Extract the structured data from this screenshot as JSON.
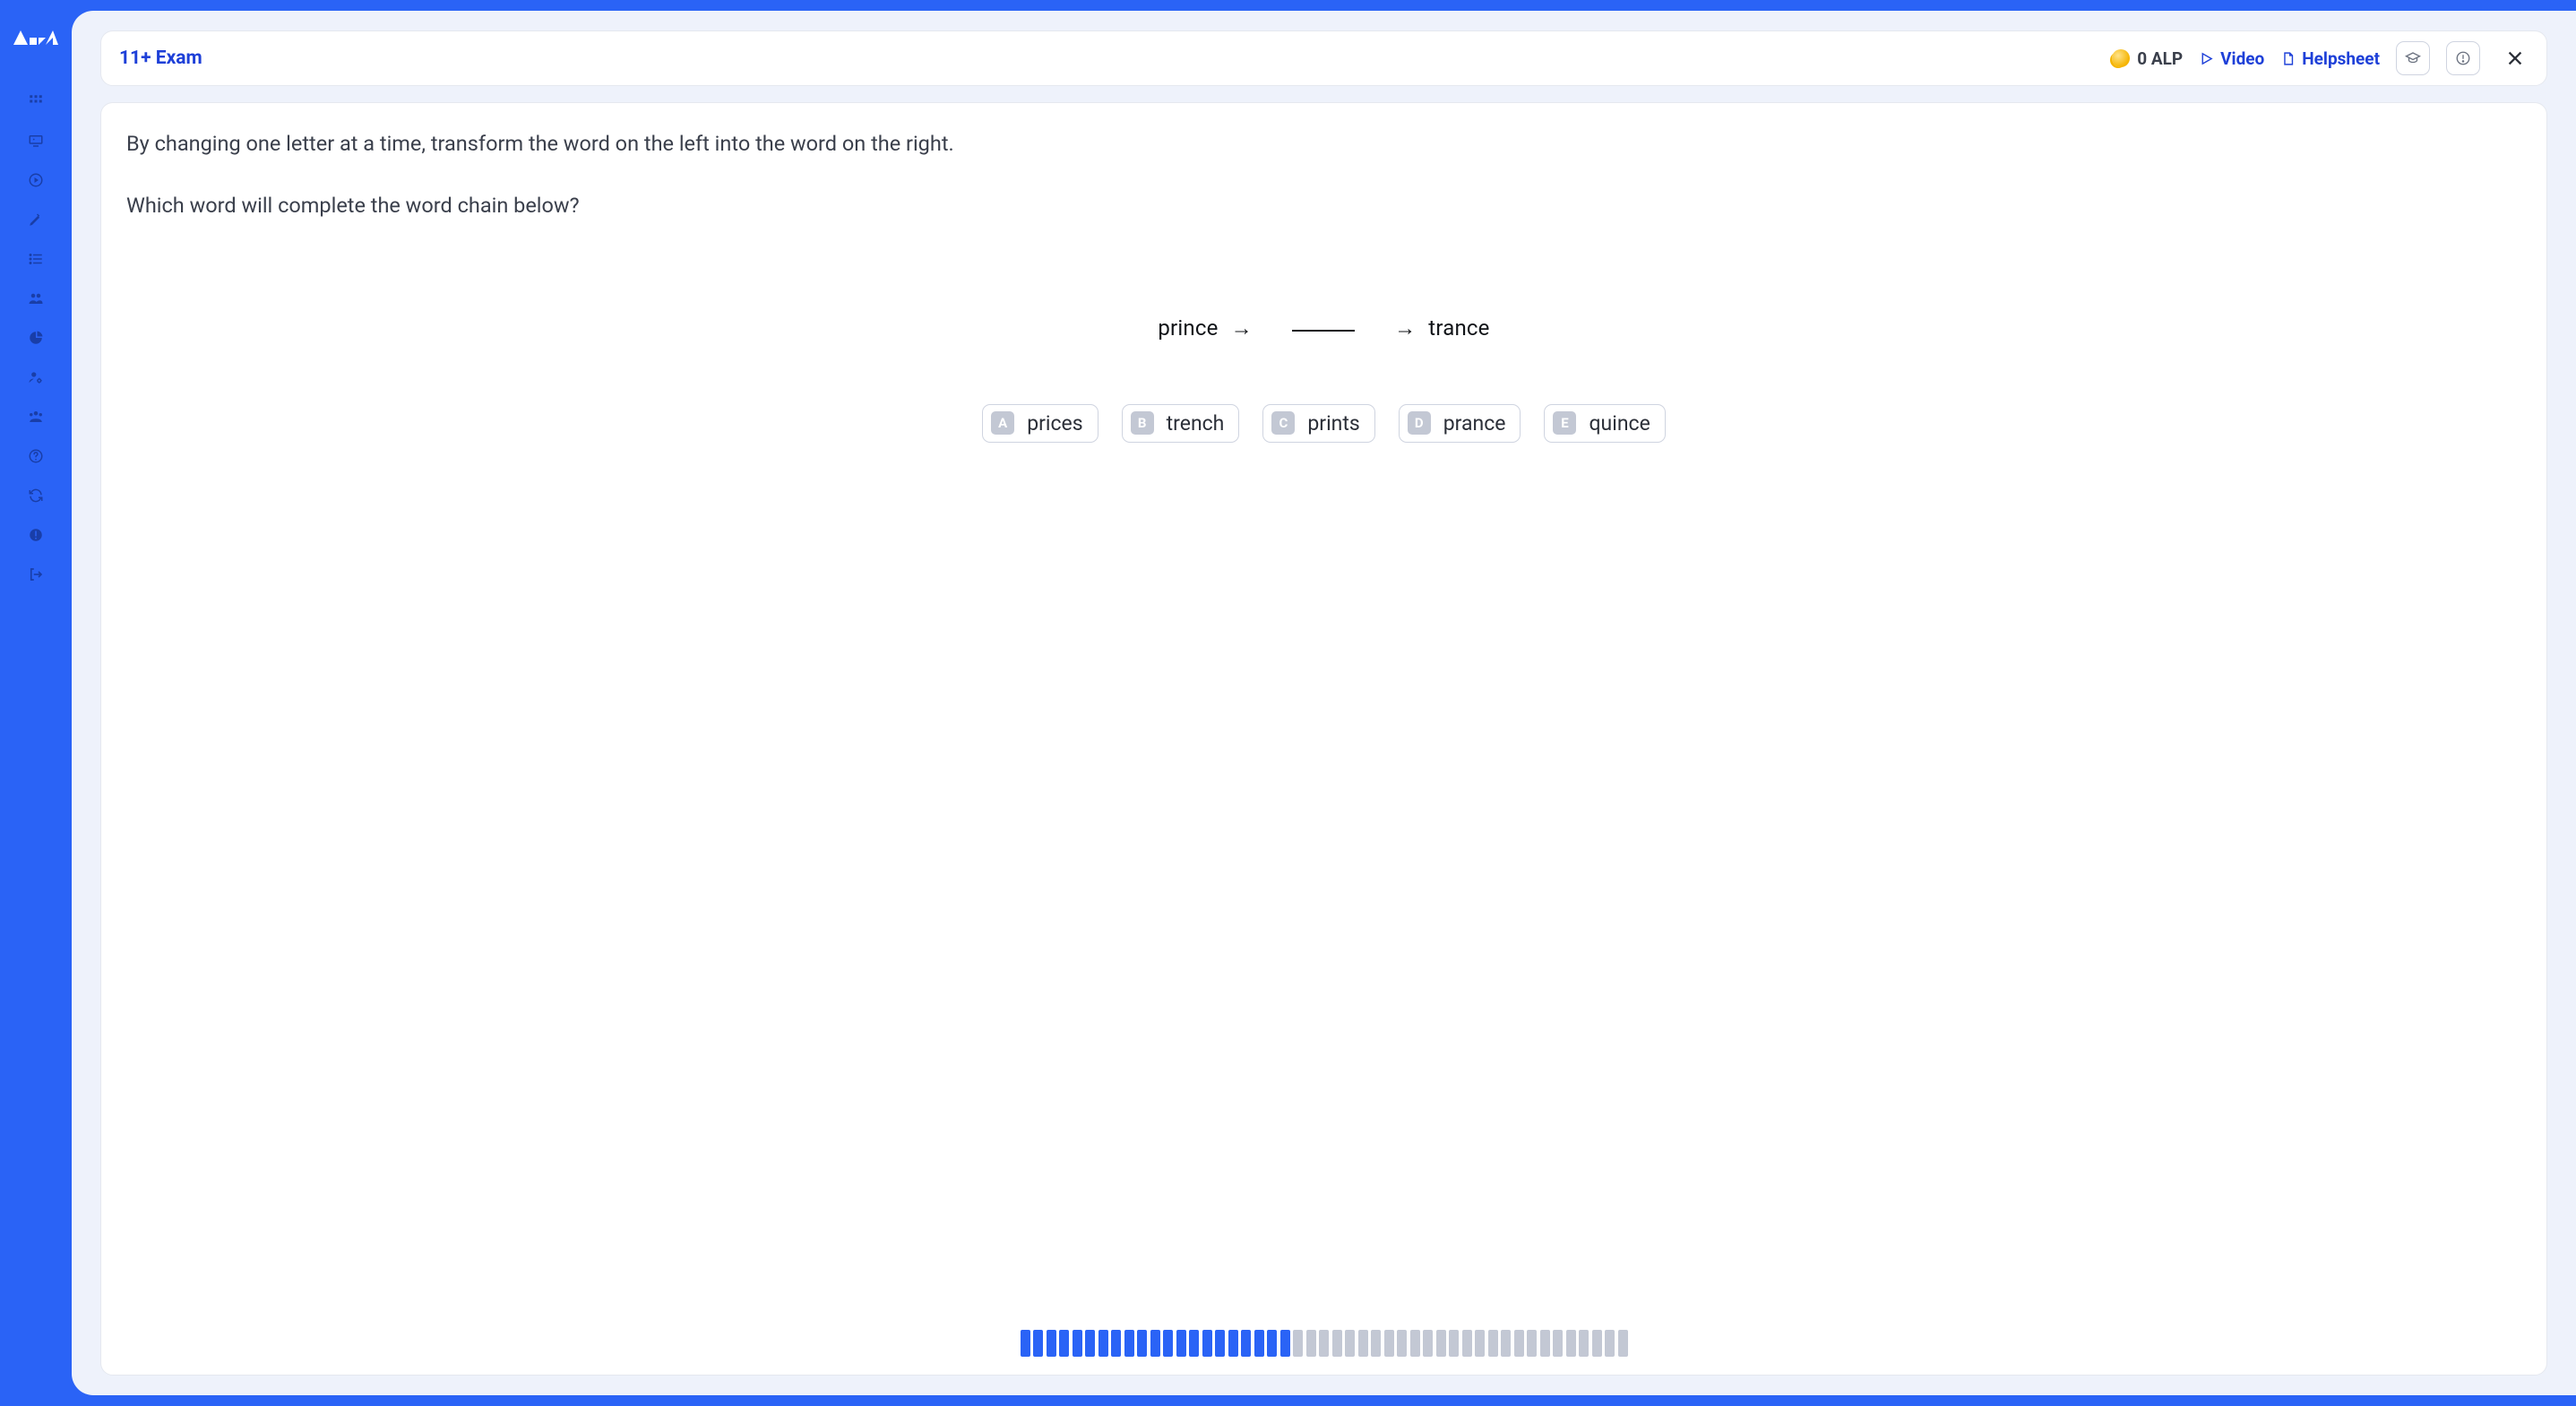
{
  "brand": "Atom",
  "header": {
    "title": "11+ Exam",
    "alp_label": "0 ALP",
    "video_label": "Video",
    "helpsheet_label": "Helpsheet"
  },
  "question": {
    "line1": "By changing one letter at a time, transform the word on the left into the word on the right.",
    "line2": "Which word will complete the word chain below?",
    "word_left": "prince",
    "arrow": "→",
    "word_right": "trance"
  },
  "options": [
    {
      "key": "A",
      "label": "prices"
    },
    {
      "key": "B",
      "label": "trench"
    },
    {
      "key": "C",
      "label": "prints"
    },
    {
      "key": "D",
      "label": "prance"
    },
    {
      "key": "E",
      "label": "quince"
    }
  ],
  "progress": {
    "total": 47,
    "done": 21
  },
  "sidebar_icons": [
    "grid-icon",
    "screen-icon",
    "play-circle-icon",
    "pencil-icon",
    "list-icon",
    "users-icon",
    "pie-icon",
    "user-gear-icon",
    "group-icon",
    "help-icon",
    "refresh-icon",
    "alert-icon",
    "logout-icon"
  ]
}
